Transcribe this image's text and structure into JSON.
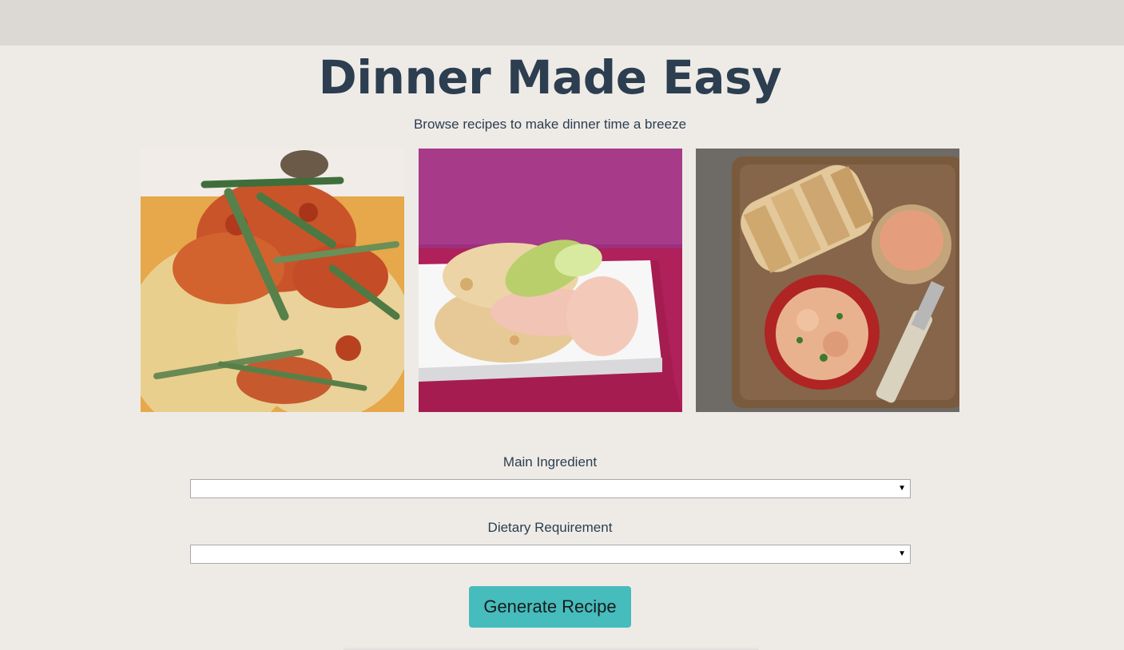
{
  "page": {
    "title": "Dinner Made Easy",
    "subtitle": "Browse recipes to make dinner time a breeze"
  },
  "photos": [
    {
      "name": "chicken-tarragon-photo"
    },
    {
      "name": "ham-apple-biscuit-photo"
    },
    {
      "name": "salmon-spread-bread-photo"
    }
  ],
  "form": {
    "main_ingredient": {
      "label": "Main Ingredient",
      "selected": ""
    },
    "dietary_requirement": {
      "label": "Dietary Requirement",
      "selected": ""
    },
    "generate_label": "Generate Recipe"
  },
  "colors": {
    "background": "#eeebe7",
    "topbar": "#dcd9d5",
    "heading": "#2c3e50",
    "button": "#46bcbc"
  }
}
